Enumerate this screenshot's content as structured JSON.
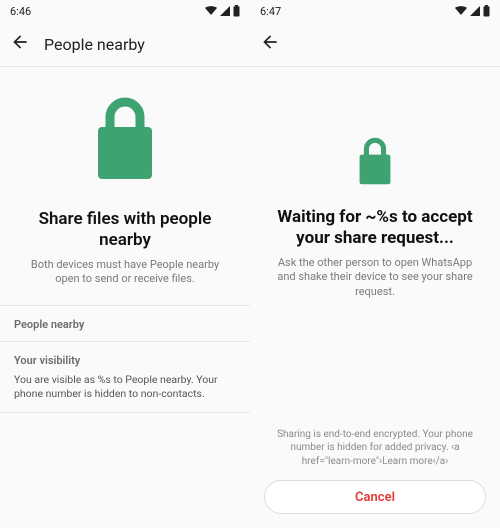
{
  "colors": {
    "accent_green": "#3fa371",
    "danger": "#e53935"
  },
  "left": {
    "status_time": "6:46",
    "appbar_title": "People nearby",
    "headline": "Share files with people nearby",
    "sub": "Both devices must have People nearby open to send or receive files.",
    "section_nearby_label": "People nearby",
    "section_visibility_label": "Your visibility",
    "visibility_desc": "You are visible as %s to People nearby. Your phone number is hidden to non-contacts."
  },
  "right": {
    "status_time": "6:47",
    "headline": "Waiting for ~%s to accept your share request...",
    "sub": "Ask the other person to open WhatsApp and shake their device to see your share request.",
    "encryption_note": "Sharing is end-to-end encrypted. Your phone number is hidden for added privacy. ‹a href=\"learn-more\"›Learn more‹/a›",
    "cancel_label": "Cancel"
  }
}
